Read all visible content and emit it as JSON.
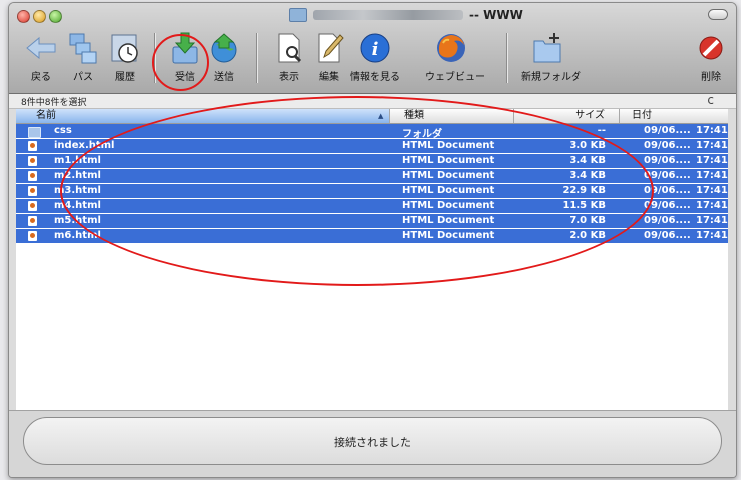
{
  "window": {
    "title_suffix": "-- WWW"
  },
  "toolbar": {
    "items": [
      {
        "label": "戻る",
        "icon": "back-arrow-icon"
      },
      {
        "label": "パス",
        "icon": "path-folders-icon"
      },
      {
        "label": "履歴",
        "icon": "history-clock-icon"
      },
      {
        "label": "受信",
        "icon": "download-icon"
      },
      {
        "label": "送信",
        "icon": "upload-globe-icon"
      },
      {
        "label": "表示",
        "icon": "view-document-icon"
      },
      {
        "label": "編集",
        "icon": "edit-pencil-icon"
      },
      {
        "label": "情報を見る",
        "icon": "info-icon"
      },
      {
        "label": "ウェブビュー",
        "icon": "firefox-icon"
      },
      {
        "label": "新規フォルダ",
        "icon": "new-folder-icon"
      },
      {
        "label": "削除",
        "icon": "delete-icon"
      }
    ]
  },
  "status": {
    "selection": "8件中8件を選択",
    "refresh": "c"
  },
  "columns": {
    "name": "名前",
    "kind": "種類",
    "size": "サイズ",
    "date": "日付"
  },
  "files": [
    {
      "name": "css",
      "kind": "フォルダ",
      "size": "--",
      "date": "09/06....",
      "time": "17:41",
      "type": "folder"
    },
    {
      "name": "index.html",
      "kind": "HTML Document",
      "size": "3.0 KB",
      "date": "09/06....",
      "time": "17:41",
      "type": "file"
    },
    {
      "name": "m1.html",
      "kind": "HTML Document",
      "size": "3.4 KB",
      "date": "09/06....",
      "time": "17:41",
      "type": "file"
    },
    {
      "name": "m2.html",
      "kind": "HTML Document",
      "size": "3.4 KB",
      "date": "09/06....",
      "time": "17:41",
      "type": "file"
    },
    {
      "name": "m3.html",
      "kind": "HTML Document",
      "size": "22.9 KB",
      "date": "09/06....",
      "time": "17:41",
      "type": "file"
    },
    {
      "name": "m4.html",
      "kind": "HTML Document",
      "size": "11.5 KB",
      "date": "09/06....",
      "time": "17:41",
      "type": "file"
    },
    {
      "name": "m5.html",
      "kind": "HTML Document",
      "size": "7.0 KB",
      "date": "09/06....",
      "time": "17:41",
      "type": "file"
    },
    {
      "name": "m6.html",
      "kind": "HTML Document",
      "size": "2.0 KB",
      "date": "09/06....",
      "time": "17:41",
      "type": "file"
    }
  ],
  "footer": {
    "connection_status": "接続されました"
  },
  "colors": {
    "selection": "#3a6ed6",
    "annotation": "#e21a1a"
  }
}
